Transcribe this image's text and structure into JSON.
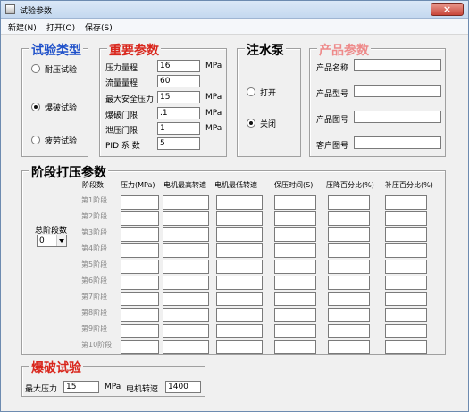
{
  "window": {
    "title": "试验参数",
    "close": "×"
  },
  "menu": [
    "新建(N)",
    "打开(O)",
    "保存(S)"
  ],
  "test_type": {
    "title": "试验类型",
    "options": [
      {
        "label": "耐压试验",
        "checked": false
      },
      {
        "label": "爆破试验",
        "checked": true
      },
      {
        "label": "疲劳试验",
        "checked": false
      }
    ]
  },
  "important": {
    "title": "重要参数",
    "rows": [
      {
        "label": "压力量程",
        "value": "16",
        "unit": "MPa"
      },
      {
        "label": "流量量程",
        "value": "60",
        "unit": ""
      },
      {
        "label": "最大安全压力",
        "value": "15",
        "unit": "MPa"
      },
      {
        "label": "爆破门限",
        "value": ".1",
        "unit": "MPa"
      },
      {
        "label": "泄压门限",
        "value": "1",
        "unit": "MPa"
      },
      {
        "label": "PID 系 数",
        "value": "5",
        "unit": ""
      }
    ]
  },
  "pump": {
    "title": "注水泵",
    "options": [
      {
        "label": "打开",
        "checked": false
      },
      {
        "label": "关闭",
        "checked": true
      }
    ]
  },
  "product": {
    "title": "产品参数",
    "rows": [
      {
        "label": "产品名称",
        "value": ""
      },
      {
        "label": "产品型号",
        "value": ""
      },
      {
        "label": "产品图号",
        "value": ""
      },
      {
        "label": "客户图号",
        "value": ""
      }
    ]
  },
  "stage": {
    "title": "阶段打压参数",
    "columns": [
      "阶段数",
      "压力(MPa)",
      "电机最高转速",
      "电机最低转速",
      "保压时间(S)",
      "压降百分比(%)",
      "补压百分比(%)"
    ],
    "total_label": "总阶段数",
    "total_value": "0",
    "rows": [
      "第1阶段",
      "第2阶段",
      "第3阶段",
      "第4阶段",
      "第5阶段",
      "第6阶段",
      "第7阶段",
      "第8阶段",
      "第9阶段",
      "第10阶段"
    ]
  },
  "burst": {
    "title": "爆破试验",
    "max_pressure_label": "最大压力",
    "max_pressure_value": "15",
    "pressure_unit": "MPa",
    "motor_speed_label": "电机转速",
    "motor_speed_value": "1400"
  }
}
